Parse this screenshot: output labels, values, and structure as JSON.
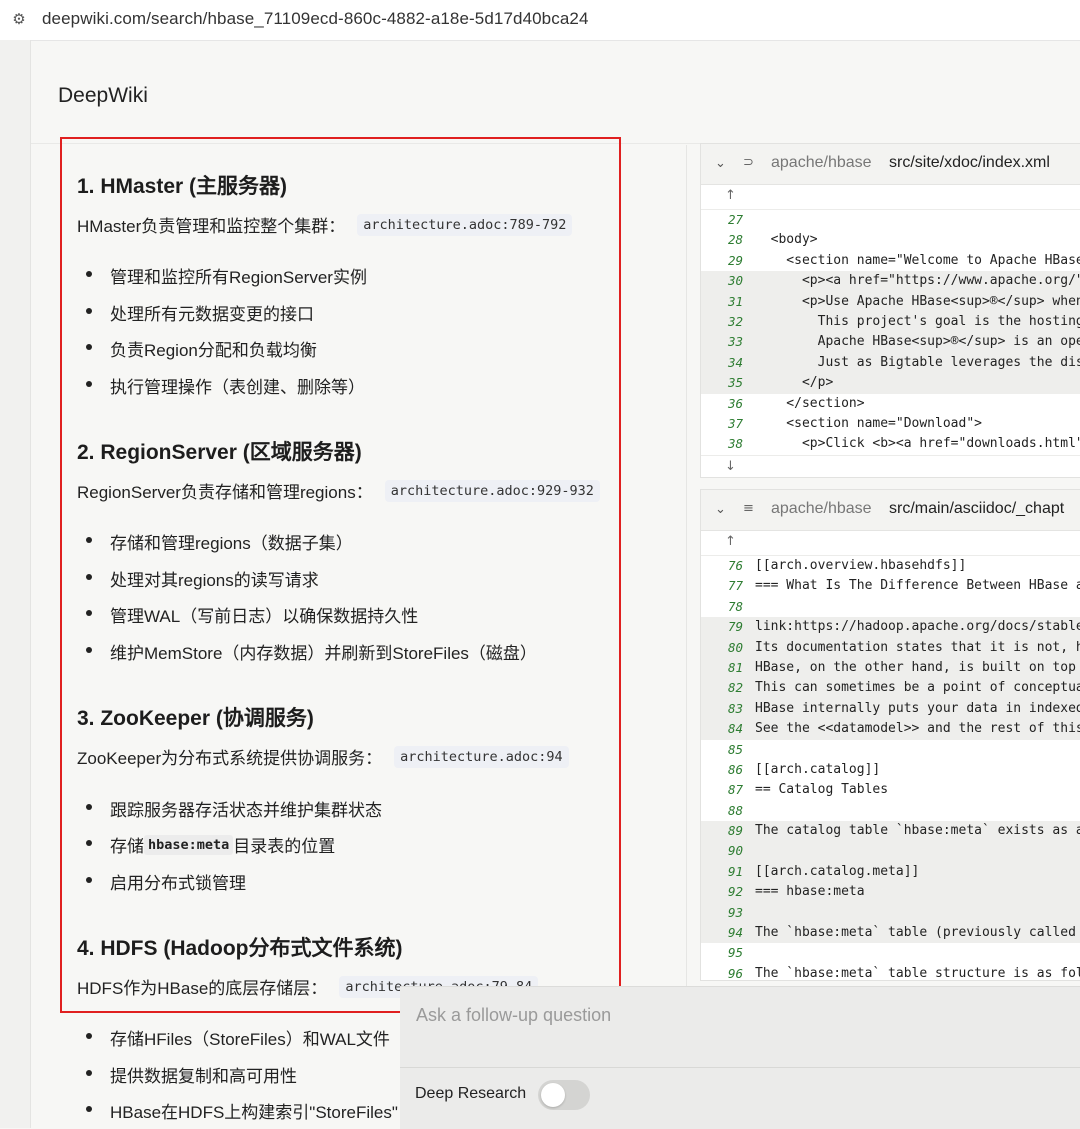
{
  "browser": {
    "url": "deepwiki.com/search/hbase_71109ecd-860c-4882-a18e-5d17d40bca24",
    "site_icon": "tune-icon"
  },
  "header": {
    "brand": "DeepWiki"
  },
  "answer": {
    "sections": [
      {
        "title": "1. HMaster (主服务器)",
        "intro": "HMaster负责管理和监控整个集群：",
        "cite": "architecture.adoc:789-792",
        "bullets": [
          "管理和监控所有RegionServer实例",
          "处理所有元数据变更的接口",
          "负责Region分配和负载均衡",
          "执行管理操作（表创建、删除等）"
        ]
      },
      {
        "title": "2. RegionServer (区域服务器)",
        "intro": "RegionServer负责存储和管理regions：",
        "cite": "architecture.adoc:929-932",
        "bullets": [
          "存储和管理regions（数据子集）",
          "处理对其regions的读写请求",
          "管理WAL（写前日志）以确保数据持久性",
          "维护MemStore（内存数据）并刷新到StoreFiles（磁盘）"
        ]
      },
      {
        "title": "3. ZooKeeper (协调服务)",
        "intro": "ZooKeeper为分布式系统提供协调服务：",
        "cite": "architecture.adoc:94",
        "bullets": [
          "跟踪服务器存活状态并维护集群状态",
          "启用分布式锁管理"
        ],
        "meta_bullet": {
          "prefix": "存储",
          "code": "hbase:meta",
          "suffix": "目录表的位置"
        }
      },
      {
        "title": "4. HDFS (Hadoop分布式文件系统)",
        "intro": "HDFS作为HBase的底层存储层：",
        "cite": "architecture.adoc:79-84",
        "bullets": [
          "存储HFiles（StoreFiles）和WAL文件",
          "提供数据复制和高可用性",
          "HBase在HDFS上构建索引\"StoreFiles\""
        ]
      }
    ]
  },
  "code_panels": [
    {
      "repo": "apache/hbase",
      "path": "src/site/xdoc/index.xml",
      "icon": "rss-icon",
      "lines": [
        {
          "n": "27",
          "t": "",
          "hl": false
        },
        {
          "n": "28",
          "t": "  <body>",
          "hl": false
        },
        {
          "n": "29",
          "t": "    <section name=\"Welcome to Apache HBase",
          "hl": false
        },
        {
          "n": "30",
          "t": "      <p><a href=\"https://www.apache.org/\" ",
          "hl": true
        },
        {
          "n": "31",
          "t": "      <p>Use Apache HBase<sup>®</sup> when",
          "hl": true
        },
        {
          "n": "32",
          "t": "        This project's goal is the hosting",
          "hl": true
        },
        {
          "n": "33",
          "t": "        Apache HBase<sup>®</sup> is an ope",
          "hl": true
        },
        {
          "n": "34",
          "t": "        Just as Bigtable leverages the dis",
          "hl": true
        },
        {
          "n": "35",
          "t": "      </p>",
          "hl": true
        },
        {
          "n": "36",
          "t": "    </section>",
          "hl": false
        },
        {
          "n": "37",
          "t": "    <section name=\"Download\">",
          "hl": false
        },
        {
          "n": "38",
          "t": "      <p>Click <b><a href=\"downloads.html\"",
          "hl": false
        }
      ]
    },
    {
      "repo": "apache/hbase",
      "path": "src/main/asciidoc/_chapt",
      "icon": "doc-icon",
      "lines": [
        {
          "n": "76",
          "t": "[[arch.overview.hbasehdfs]]",
          "hl": false
        },
        {
          "n": "77",
          "t": "=== What Is The Difference Between HBase an",
          "hl": false
        },
        {
          "n": "78",
          "t": "",
          "hl": false
        },
        {
          "n": "79",
          "t": "link:https://hadoop.apache.org/docs/stable/",
          "hl": true
        },
        {
          "n": "80",
          "t": "Its documentation states that it is not, ho",
          "hl": true
        },
        {
          "n": "81",
          "t": "HBase, on the other hand, is built on top o",
          "hl": true
        },
        {
          "n": "82",
          "t": "This can sometimes be a point of conceptua",
          "hl": true
        },
        {
          "n": "83",
          "t": "HBase internally puts your data in indexed",
          "hl": true
        },
        {
          "n": "84",
          "t": "See the <<datamodel>> and the rest of this",
          "hl": true
        },
        {
          "n": "85",
          "t": "",
          "hl": false
        },
        {
          "n": "86",
          "t": "[[arch.catalog]]",
          "hl": false
        },
        {
          "n": "87",
          "t": "== Catalog Tables",
          "hl": false
        },
        {
          "n": "88",
          "t": "",
          "hl": false
        },
        {
          "n": "89",
          "t": "The catalog table `hbase:meta` exists as an",
          "hl": true
        },
        {
          "n": "90",
          "t": "",
          "hl": true
        },
        {
          "n": "91",
          "t": "[[arch.catalog.meta]]",
          "hl": true
        },
        {
          "n": "92",
          "t": "=== hbase:meta",
          "hl": true
        },
        {
          "n": "93",
          "t": "",
          "hl": true
        },
        {
          "n": "94",
          "t": "The `hbase:meta` table (previously called ",
          "hl": true
        },
        {
          "n": "95",
          "t": "",
          "hl": false
        },
        {
          "n": "96",
          "t": "The `hbase:meta` table structure is as fol",
          "hl": false
        }
      ]
    }
  ],
  "followup": {
    "placeholder": "Ask a follow-up question",
    "deep_research_label": "Deep Research",
    "deep_research_on": false
  },
  "colors": {
    "highlight_box": "#e02020",
    "line_number": "#2e7d32"
  }
}
